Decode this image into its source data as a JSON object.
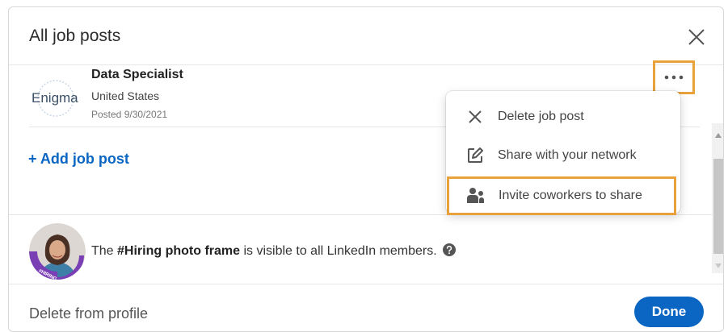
{
  "modal": {
    "title": "All job posts"
  },
  "job": {
    "company_logo_text": "Enigma",
    "title": "Data Specialist",
    "location": "United States",
    "posted": "Posted 9/30/2021"
  },
  "add_job_label": "+ Add job post",
  "menu": {
    "items": [
      {
        "label": "Delete job post",
        "icon": "close-icon"
      },
      {
        "label": "Share with your network",
        "icon": "edit-icon"
      },
      {
        "label": "Invite coworkers to share",
        "icon": "people-icon"
      }
    ]
  },
  "frame": {
    "prefix": "The ",
    "bold": "#Hiring photo frame",
    "suffix": " is visible to all LinkedIn members.",
    "avatar_badge": "#HIRING"
  },
  "footer": {
    "delete_label": "Delete from profile",
    "done_label": "Done"
  },
  "colors": {
    "accent": "#0a66c2",
    "highlight": "#e9a13b",
    "hiring_purple": "#7b3fb5"
  }
}
